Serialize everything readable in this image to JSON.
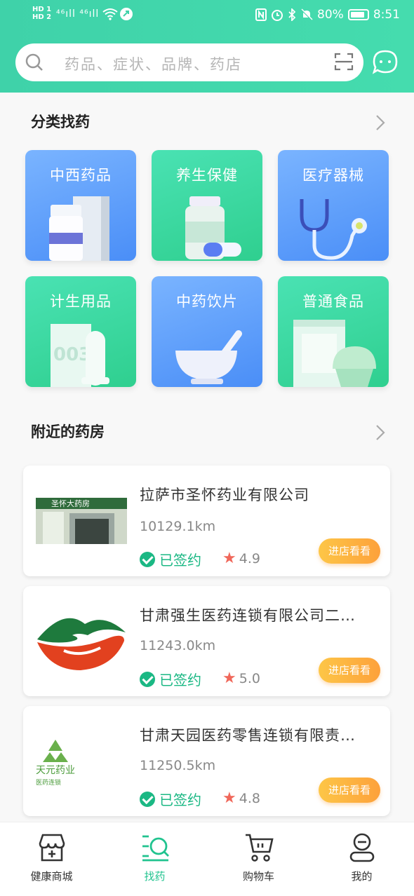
{
  "status_bar": {
    "left_hd": "HD 1\nHD 2",
    "signal": "⁴⁶ıll ⁴⁶ıll",
    "battery_percent": "80%",
    "time": "8:51"
  },
  "search": {
    "placeholder": "药品、症状、品牌、药店"
  },
  "icons": {
    "search": "search-icon",
    "scan": "scan-icon",
    "chat": "chat-icon"
  },
  "categories_section": {
    "title": "分类找药",
    "items": [
      {
        "label": "中西药品",
        "style": "blue"
      },
      {
        "label": "养生保健",
        "style": "green"
      },
      {
        "label": "医疗器械",
        "style": "blue"
      },
      {
        "label": "计生用品",
        "style": "green"
      },
      {
        "label": "中药饮片",
        "style": "blue"
      },
      {
        "label": "普通食品",
        "style": "green"
      }
    ]
  },
  "pharmacy_section": {
    "title": "附近的药房",
    "stores": [
      {
        "name": "拉萨市圣怀药业有限公司",
        "distance": "10129.1km",
        "signed": "已签约",
        "rating": "4.9",
        "button": "进店看看",
        "logo_text": "圣怀大药房"
      },
      {
        "name": "甘肃强生医药连锁有限公司二…",
        "distance": "11243.0km",
        "signed": "已签约",
        "rating": "5.0",
        "button": "进店看看"
      },
      {
        "name": "甘肃天园医药零售连锁有限责…",
        "distance": "11250.5km",
        "signed": "已签约",
        "rating": "4.8",
        "button": "进店看看",
        "logo_text": "天元药业",
        "logo_sub": "医药连锁"
      }
    ]
  },
  "tabbar": {
    "tabs": [
      {
        "label": "健康商城",
        "icon": "store-icon",
        "active": false
      },
      {
        "label": "找药",
        "icon": "find-medicine-icon",
        "active": true
      },
      {
        "label": "购物车",
        "icon": "cart-icon",
        "active": false
      },
      {
        "label": "我的",
        "icon": "profile-icon",
        "active": false
      }
    ]
  },
  "colors": {
    "accent": "#3fd2a9",
    "signed": "#1bb884",
    "button": "#fdb342",
    "star": "#f0675a"
  }
}
